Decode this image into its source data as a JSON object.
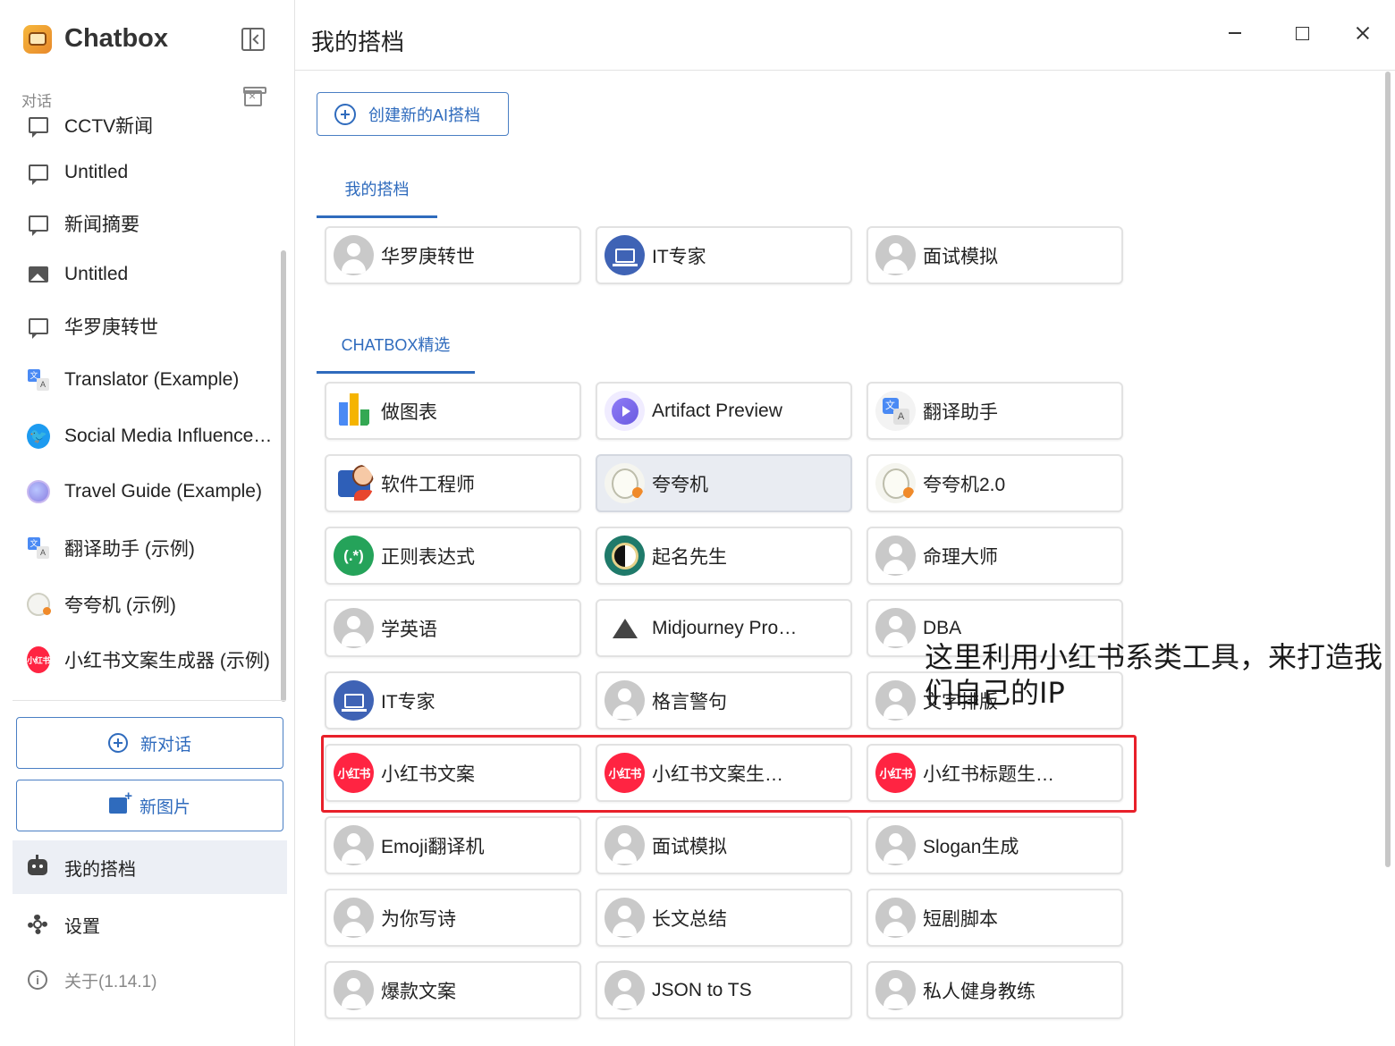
{
  "app": {
    "name": "Chatbox",
    "version_label": "关于(1.14.1)"
  },
  "sidebar": {
    "section_label": "对话",
    "conversations": [
      {
        "label": "CCTV新闻",
        "icon": "chat-bubble-icon"
      },
      {
        "label": "Untitled",
        "icon": "chat-bubble-icon"
      },
      {
        "label": "新闻摘要",
        "icon": "chat-bubble-icon"
      },
      {
        "label": "Untitled",
        "icon": "image-icon"
      },
      {
        "label": "华罗庚转世",
        "icon": "chat-bubble-icon"
      },
      {
        "label": "Translator (Example)",
        "icon": "translate-icon"
      },
      {
        "label": "Social Media Influence…",
        "icon": "twitter-icon"
      },
      {
        "label": "Travel Guide (Example)",
        "icon": "globe-icon"
      },
      {
        "label": "翻译助手 (示例)",
        "icon": "translate-icon"
      },
      {
        "label": "夸夸机 (示例)",
        "icon": "sheep-icon"
      },
      {
        "label": "小红书文案生成器 (示例)",
        "icon": "xiaohongshu-icon"
      }
    ],
    "xhs_badge": "小红书",
    "new_chat_label": "新对话",
    "new_image_label": "新图片",
    "nav": {
      "copilots_label": "我的搭档",
      "settings_label": "设置"
    }
  },
  "main": {
    "title": "我的搭档",
    "create_button_label": "创建新的AI搭档",
    "tabs": {
      "mine": "我的搭档",
      "featured": "CHATBOX精选"
    },
    "my_copilots": [
      {
        "label": "华罗庚转世",
        "avatar": "default-avatar-icon"
      },
      {
        "label": "IT专家",
        "avatar": "laptop-icon"
      },
      {
        "label": "面试模拟",
        "avatar": "default-avatar-icon"
      }
    ],
    "featured": [
      {
        "label": "做图表",
        "avatar": "bar-chart-icon"
      },
      {
        "label": "Artifact Preview",
        "avatar": "play-icon"
      },
      {
        "label": "翻译助手",
        "avatar": "translate-icon"
      },
      {
        "label": "软件工程师",
        "avatar": "coder-icon"
      },
      {
        "label": "夸夸机",
        "avatar": "sheep-icon",
        "selected": true
      },
      {
        "label": "夸夸机2.0",
        "avatar": "sheep-icon"
      },
      {
        "label": "正则表达式",
        "avatar": "regex-icon",
        "badge": "(.*)"
      },
      {
        "label": "起名先生",
        "avatar": "yin-yang-icon"
      },
      {
        "label": "命理大师",
        "avatar": "default-avatar-icon"
      },
      {
        "label": "学英语",
        "avatar": "default-avatar-icon"
      },
      {
        "label": "Midjourney Pro…",
        "avatar": "sailboat-icon"
      },
      {
        "label": "DBA",
        "avatar": "default-avatar-icon"
      },
      {
        "label": "IT专家",
        "avatar": "laptop-icon"
      },
      {
        "label": "格言警句",
        "avatar": "default-avatar-icon"
      },
      {
        "label": "文字排版",
        "avatar": "default-avatar-icon"
      },
      {
        "label": "小红书文案",
        "avatar": "xiaohongshu-icon"
      },
      {
        "label": "小红书文案生…",
        "avatar": "xiaohongshu-icon"
      },
      {
        "label": "小红书标题生…",
        "avatar": "xiaohongshu-icon"
      },
      {
        "label": "Emoji翻译机",
        "avatar": "default-avatar-icon"
      },
      {
        "label": "面试模拟",
        "avatar": "default-avatar-icon"
      },
      {
        "label": "Slogan生成",
        "avatar": "default-avatar-icon"
      },
      {
        "label": "为你写诗",
        "avatar": "default-avatar-icon"
      },
      {
        "label": "长文总结",
        "avatar": "default-avatar-icon"
      },
      {
        "label": "短剧脚本",
        "avatar": "default-avatar-icon"
      },
      {
        "label": "爆款文案",
        "avatar": "default-avatar-icon"
      },
      {
        "label": "JSON to TS",
        "avatar": "default-avatar-icon"
      },
      {
        "label": "私人健身教练",
        "avatar": "default-avatar-icon"
      }
    ]
  },
  "annotation": {
    "text": "这里利用小红书系类工具，来打造我们自己的IP",
    "highlight_color": "#e8202a"
  },
  "colors": {
    "accent": "#2f6bbd",
    "xiaohongshu_red": "#ff2442",
    "selected_card_bg": "#e9ecf2"
  }
}
